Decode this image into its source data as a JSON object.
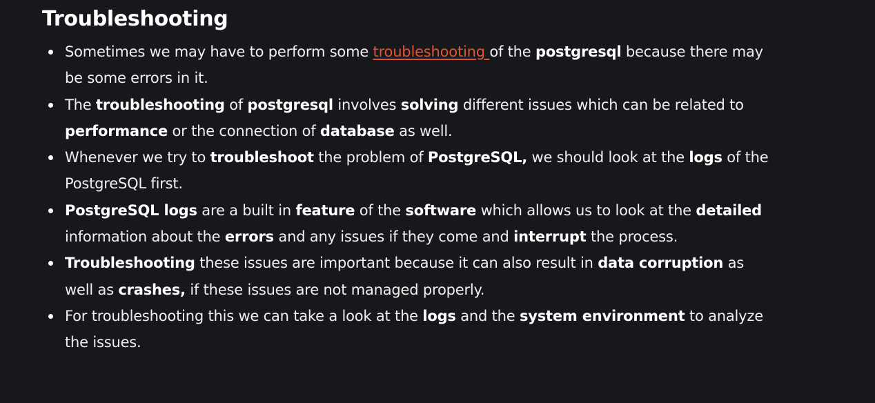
{
  "heading": "Troubleshooting",
  "colors": {
    "background": "#17181c",
    "text": "#f0f0f0",
    "link": "#e5532f"
  },
  "items": [
    {
      "segments": [
        {
          "text": "Sometimes we may have to perform some "
        },
        {
          "text": "troubleshooting ",
          "link": true
        },
        {
          "text": "of the "
        },
        {
          "text": "postgresql",
          "bold": true
        },
        {
          "text": " because there may be some errors in it."
        }
      ]
    },
    {
      "segments": [
        {
          "text": "The "
        },
        {
          "text": "troubleshooting",
          "bold": true
        },
        {
          "text": " of "
        },
        {
          "text": "postgresql",
          "bold": true
        },
        {
          "text": " involves "
        },
        {
          "text": "solving",
          "bold": true
        },
        {
          "text": " different issues which can be related to "
        },
        {
          "text": "performance",
          "bold": true
        },
        {
          "text": " or the connection of "
        },
        {
          "text": "database",
          "bold": true
        },
        {
          "text": " as well."
        }
      ]
    },
    {
      "segments": [
        {
          "text": "Whenever we try to "
        },
        {
          "text": "troubleshoot",
          "bold": true
        },
        {
          "text": " the problem of "
        },
        {
          "text": "PostgreSQL,",
          "bold": true
        },
        {
          "text": " we should look at the "
        },
        {
          "text": "logs",
          "bold": true
        },
        {
          "text": " of the PostgreSQL first."
        }
      ]
    },
    {
      "segments": [
        {
          "text": "PostgreSQL logs",
          "bold": true
        },
        {
          "text": " are a built in "
        },
        {
          "text": "feature",
          "bold": true
        },
        {
          "text": " of the "
        },
        {
          "text": "software",
          "bold": true
        },
        {
          "text": " which allows us to look at the "
        },
        {
          "text": "detailed",
          "bold": true
        },
        {
          "text": " information about the "
        },
        {
          "text": "errors",
          "bold": true
        },
        {
          "text": " and any issues if they come and "
        },
        {
          "text": "interrupt",
          "bold": true
        },
        {
          "text": " the process."
        }
      ]
    },
    {
      "segments": [
        {
          "text": "Troubleshooting",
          "bold": true
        },
        {
          "text": " these issues are important because it can also result in "
        },
        {
          "text": "data corruption",
          "bold": true
        },
        {
          "text": " as well as "
        },
        {
          "text": "crashes,",
          "bold": true
        },
        {
          "text": " if these issues are not managed properly."
        }
      ]
    },
    {
      "segments": [
        {
          "text": "For troubleshooting this we can take a look at the "
        },
        {
          "text": "logs",
          "bold": true
        },
        {
          "text": " and the "
        },
        {
          "text": "system environment",
          "bold": true
        },
        {
          "text": " to analyze the issues."
        }
      ]
    }
  ]
}
